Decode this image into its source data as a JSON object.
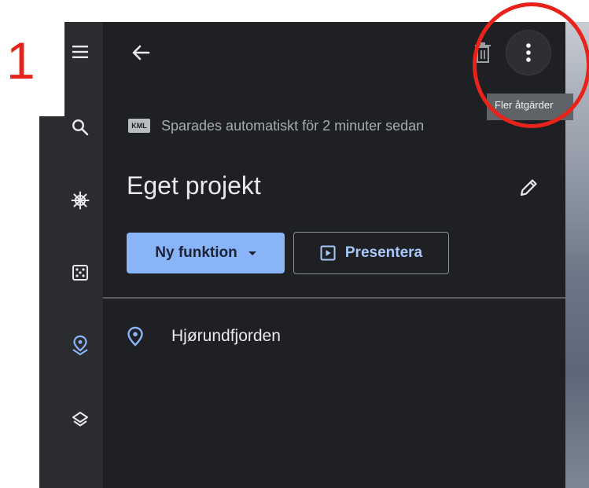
{
  "annotation": {
    "step_number": "1"
  },
  "sidebar": {
    "items": [
      {
        "icon": "menu-icon"
      },
      {
        "icon": "search-icon"
      },
      {
        "icon": "ship-wheel-icon"
      },
      {
        "icon": "dice-icon"
      },
      {
        "icon": "place-pin-icon",
        "active": true
      },
      {
        "icon": "layers-icon"
      }
    ]
  },
  "header": {
    "back_icon": "arrow-left-icon",
    "delete_icon": "trash-icon",
    "more_icon": "more-vertical-icon",
    "more_tooltip": "Fler åtgärder"
  },
  "autosave": {
    "badge": "KML",
    "text": "Sparades automatiskt för 2 minuter sedan"
  },
  "project": {
    "title": "Eget projekt",
    "edit_icon": "pencil-icon"
  },
  "actions": {
    "new_feature_label": "Ny funktion",
    "present_label": "Presentera"
  },
  "layers": [
    {
      "label": "Hjørundfjorden",
      "icon": "place-pin-icon"
    }
  ],
  "colors": {
    "panel_bg": "#1f2023",
    "rail_bg": "#2b2c2f",
    "accent": "#8ab4f8",
    "annotation_red": "#e8231c"
  }
}
